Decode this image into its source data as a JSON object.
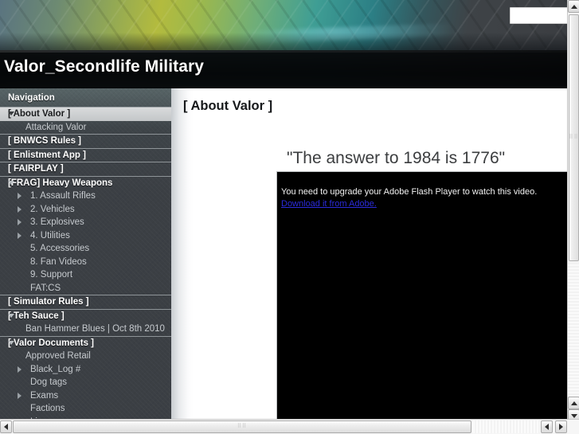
{
  "window": {
    "vertical_scrollbar": {
      "up_arrow_icon": "arrow-up-icon",
      "down_arrow_icon": "arrow-down-icon"
    },
    "horizontal_scrollbar": {
      "left_arrow_icon": "arrow-left-icon",
      "right_arrow_icon": "arrow-right-icon"
    }
  },
  "banner": {
    "search": {
      "value": "",
      "placeholder": ""
    }
  },
  "header": {
    "site_title": "Valor_Secondlife Military"
  },
  "sidebar": {
    "heading": "Navigation",
    "items": [
      {
        "label": "[ About Valor ]",
        "level": "top",
        "icon": "triangle-down-icon",
        "active": true
      },
      {
        "label": "Attacking Valor",
        "level": "child",
        "icon": ""
      },
      {
        "label": "[ BNWCS Rules ]",
        "level": "top",
        "icon": ""
      },
      {
        "label": "[ Enlistment App ]",
        "level": "top",
        "icon": ""
      },
      {
        "label": "[ FAIRPLAY ]",
        "level": "top",
        "icon": ""
      },
      {
        "label": "[FRAG] Heavy Weapons",
        "level": "top",
        "icon": "triangle-down-icon"
      },
      {
        "label": "1. Assault Rifles",
        "level": "child2",
        "icon": "triangle-right-icon"
      },
      {
        "label": "2. Vehicles",
        "level": "child2",
        "icon": "triangle-right-icon"
      },
      {
        "label": "3. Explosives",
        "level": "child2",
        "icon": "triangle-right-icon"
      },
      {
        "label": "4. Utilities",
        "level": "child2",
        "icon": "triangle-right-icon"
      },
      {
        "label": "5. Accessories",
        "level": "child2",
        "icon": ""
      },
      {
        "label": "8. Fan Videos",
        "level": "child2",
        "icon": ""
      },
      {
        "label": "9. Support",
        "level": "child2",
        "icon": ""
      },
      {
        "label": "FAT:CS",
        "level": "child2",
        "icon": ""
      },
      {
        "label": "[ Simulator Rules ]",
        "level": "top",
        "icon": ""
      },
      {
        "label": "[ Teh Sauce ]",
        "level": "top",
        "icon": "triangle-down-icon"
      },
      {
        "label": "Ban Hammer Blues | Oct 8th 2010",
        "level": "child",
        "icon": ""
      },
      {
        "label": "[ Valor Documents ]",
        "level": "top",
        "icon": "triangle-down-icon"
      },
      {
        "label": "Approved Retail",
        "level": "child",
        "icon": ""
      },
      {
        "label": "Black_Log #",
        "level": "child2",
        "icon": "triangle-right-icon"
      },
      {
        "label": "Dog tags",
        "level": "child2",
        "icon": ""
      },
      {
        "label": "Exams",
        "level": "child2",
        "icon": "triangle-right-icon"
      },
      {
        "label": "Factions",
        "level": "child2",
        "icon": ""
      },
      {
        "label": "Linux",
        "level": "child2",
        "icon": ""
      }
    ]
  },
  "content": {
    "page_title": "[ About Valor ]",
    "quote": "\"The answer to 1984 is 1776\"",
    "video": {
      "message": "You need to upgrade your Adobe Flash Player to watch this video.",
      "link_text": "Download it from Adobe."
    }
  },
  "colors": {
    "sidebar_bg": "#3b3f44",
    "sidebar_active_bg": "#d9dbdc",
    "titlebar_bg": "#272c30",
    "link": "#2b2bdd",
    "video_bg": "#000000"
  }
}
